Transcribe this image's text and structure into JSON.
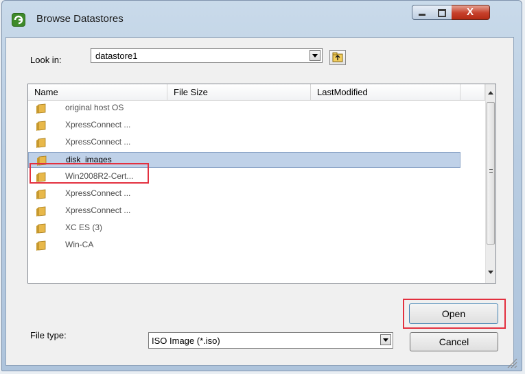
{
  "window": {
    "title": "Browse Datastores",
    "close_label": "X"
  },
  "lookin": {
    "label": "Look in:",
    "value": "datastore1"
  },
  "filelist": {
    "columns": [
      "Name",
      "File Size",
      "LastModified"
    ],
    "rows": [
      {
        "name": "original host OS",
        "selected": false
      },
      {
        "name": "XpressConnect ...",
        "selected": false
      },
      {
        "name": "XpressConnect ...",
        "selected": false
      },
      {
        "name": "disk_images",
        "selected": true
      },
      {
        "name": "Win2008R2-Cert...",
        "selected": false
      },
      {
        "name": "XpressConnect ...",
        "selected": false
      },
      {
        "name": "XpressConnect ...",
        "selected": false
      },
      {
        "name": "XC ES (3)",
        "selected": false
      },
      {
        "name": "Win-CA",
        "selected": false
      }
    ]
  },
  "filetype": {
    "label": "File type:",
    "value": "ISO Image (*.iso)"
  },
  "buttons": {
    "open": "Open",
    "cancel": "Cancel"
  },
  "colors": {
    "selection": "#bfd1e8",
    "highlight": "#e3303f",
    "folder": "#e8b84a"
  },
  "icons": {
    "app": "vsphere-logo-icon",
    "folder": "folder-icon",
    "up": "up-folder-icon"
  }
}
